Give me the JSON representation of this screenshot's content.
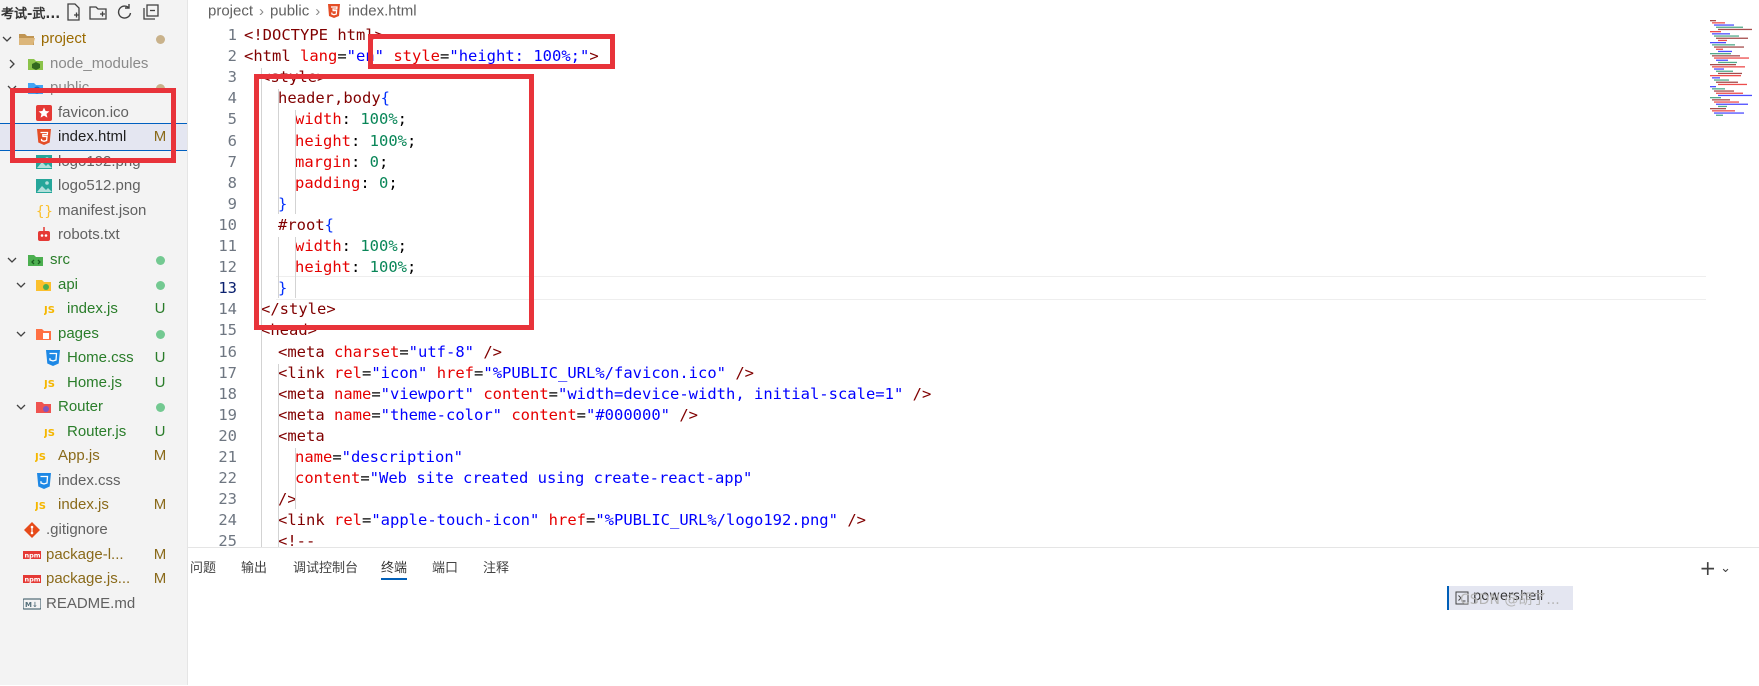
{
  "explorer": {
    "title": "考试-武...",
    "tree": [
      {
        "label": "project",
        "kind": "folder-open",
        "depth": 0,
        "color": "#9a6a00",
        "status": "dot",
        "status_color": "#c9b28b"
      },
      {
        "label": "node_modules",
        "kind": "node-folder",
        "depth": 1,
        "color": "#8a8a8a",
        "collapsed": true
      },
      {
        "label": "public",
        "kind": "public-folder",
        "depth": 1,
        "color": "#8a8a8a",
        "status": "dot",
        "status_color": "#c9b28b"
      },
      {
        "label": "favicon.ico",
        "kind": "favicon",
        "depth": 2,
        "color": "#616161"
      },
      {
        "label": "index.html",
        "kind": "html",
        "depth": 2,
        "color": "#1f1f1f",
        "badge": "M",
        "badge_color": "#8a6a1a",
        "selected": true
      },
      {
        "label": "logo192.png",
        "kind": "image",
        "depth": 2,
        "color": "#616161"
      },
      {
        "label": "logo512.png",
        "kind": "image",
        "depth": 2,
        "color": "#616161"
      },
      {
        "label": "manifest.json",
        "kind": "json",
        "depth": 2,
        "color": "#616161"
      },
      {
        "label": "robots.txt",
        "kind": "robot",
        "depth": 2,
        "color": "#616161"
      },
      {
        "label": "src",
        "kind": "src-folder",
        "depth": 1,
        "color": "#2a7d2a",
        "status": "dot",
        "status_color": "#73c991"
      },
      {
        "label": "api",
        "kind": "api-folder",
        "depth": 2,
        "color": "#2a7d2a",
        "status": "dot",
        "status_color": "#73c991"
      },
      {
        "label": "index.js",
        "kind": "js",
        "depth": 3,
        "color": "#2a7d2a",
        "badge": "U",
        "badge_color": "#2a7d2a"
      },
      {
        "label": "pages",
        "kind": "pages-folder",
        "depth": 2,
        "color": "#2a7d2a",
        "status": "dot",
        "status_color": "#73c991"
      },
      {
        "label": "Home.css",
        "kind": "css",
        "depth": 3,
        "color": "#2a7d2a",
        "badge": "U",
        "badge_color": "#2a7d2a"
      },
      {
        "label": "Home.js",
        "kind": "js",
        "depth": 3,
        "color": "#2a7d2a",
        "badge": "U",
        "badge_color": "#2a7d2a"
      },
      {
        "label": "Router",
        "kind": "router-folder",
        "depth": 2,
        "color": "#2a7d2a",
        "status": "dot",
        "status_color": "#73c991"
      },
      {
        "label": "Router.js",
        "kind": "js",
        "depth": 3,
        "color": "#2a7d2a",
        "badge": "U",
        "badge_color": "#2a7d2a"
      },
      {
        "label": "App.js",
        "kind": "js",
        "depth": 2,
        "color": "#8a6a1a",
        "badge": "M",
        "badge_color": "#8a6a1a"
      },
      {
        "label": "index.css",
        "kind": "css",
        "depth": 2,
        "color": "#616161"
      },
      {
        "label": "index.js",
        "kind": "js",
        "depth": 2,
        "color": "#8a6a1a",
        "badge": "M",
        "badge_color": "#8a6a1a"
      },
      {
        "label": ".gitignore",
        "kind": "git",
        "depth": 1,
        "color": "#616161"
      },
      {
        "label": "package-l...",
        "kind": "npm",
        "depth": 1,
        "color": "#8a6a1a",
        "badge": "M",
        "badge_color": "#8a6a1a"
      },
      {
        "label": "package.js...",
        "kind": "npm",
        "depth": 1,
        "color": "#8a6a1a",
        "badge": "M",
        "badge_color": "#8a6a1a"
      },
      {
        "label": "README.md",
        "kind": "md",
        "depth": 1,
        "color": "#616161"
      }
    ]
  },
  "breadcrumb": [
    "project",
    "public",
    "index.html"
  ],
  "editor": {
    "active_line": 13,
    "lines": [
      {
        "n": 1,
        "indent": 0,
        "tokens": [
          [
            "tag",
            "<!DOCTYPE html>"
          ]
        ]
      },
      {
        "n": 2,
        "indent": 0,
        "tokens": [
          [
            "tag",
            "<html "
          ],
          [
            "attr",
            "lang"
          ],
          [
            "plain",
            "="
          ],
          [
            "str",
            "\"en\""
          ],
          [
            "plain",
            " "
          ],
          [
            "attr",
            "style"
          ],
          [
            "plain",
            "="
          ],
          [
            "str",
            "\"height: 100%;\""
          ],
          [
            "tag",
            ">"
          ]
        ]
      },
      {
        "n": 3,
        "indent": 1,
        "tokens": [
          [
            "tag",
            "<style>"
          ]
        ]
      },
      {
        "n": 4,
        "indent": 2,
        "tokens": [
          [
            "sel",
            "header,body"
          ],
          [
            "brace",
            "{"
          ]
        ]
      },
      {
        "n": 5,
        "indent": 3,
        "tokens": [
          [
            "prop",
            "width"
          ],
          [
            "plain",
            ": "
          ],
          [
            "num",
            "100%"
          ],
          [
            "plain",
            ";"
          ]
        ]
      },
      {
        "n": 6,
        "indent": 3,
        "tokens": [
          [
            "prop",
            "height"
          ],
          [
            "plain",
            ": "
          ],
          [
            "num",
            "100%"
          ],
          [
            "plain",
            ";"
          ]
        ]
      },
      {
        "n": 7,
        "indent": 3,
        "tokens": [
          [
            "prop",
            "margin"
          ],
          [
            "plain",
            ": "
          ],
          [
            "num",
            "0"
          ],
          [
            "plain",
            ";"
          ]
        ]
      },
      {
        "n": 8,
        "indent": 3,
        "tokens": [
          [
            "prop",
            "padding"
          ],
          [
            "plain",
            ": "
          ],
          [
            "num",
            "0"
          ],
          [
            "plain",
            ";"
          ]
        ]
      },
      {
        "n": 9,
        "indent": 2,
        "tokens": [
          [
            "brace",
            "}"
          ]
        ]
      },
      {
        "n": 10,
        "indent": 2,
        "tokens": [
          [
            "sel",
            "#root"
          ],
          [
            "brace",
            "{"
          ]
        ]
      },
      {
        "n": 11,
        "indent": 3,
        "tokens": [
          [
            "prop",
            "width"
          ],
          [
            "plain",
            ": "
          ],
          [
            "num",
            "100%"
          ],
          [
            "plain",
            ";"
          ]
        ]
      },
      {
        "n": 12,
        "indent": 3,
        "tokens": [
          [
            "prop",
            "height"
          ],
          [
            "plain",
            ": "
          ],
          [
            "num",
            "100%"
          ],
          [
            "plain",
            ";"
          ]
        ]
      },
      {
        "n": 13,
        "indent": 2,
        "tokens": [
          [
            "brace",
            "}"
          ]
        ]
      },
      {
        "n": 14,
        "indent": 1,
        "tokens": [
          [
            "tag",
            "</style>"
          ]
        ]
      },
      {
        "n": 15,
        "indent": 1,
        "tokens": [
          [
            "tag",
            "<head>"
          ]
        ]
      },
      {
        "n": 16,
        "indent": 2,
        "tokens": [
          [
            "tag",
            "<meta "
          ],
          [
            "attr",
            "charset"
          ],
          [
            "plain",
            "="
          ],
          [
            "str",
            "\"utf-8\""
          ],
          [
            "tag",
            " />"
          ]
        ]
      },
      {
        "n": 17,
        "indent": 2,
        "tokens": [
          [
            "tag",
            "<link "
          ],
          [
            "attr",
            "rel"
          ],
          [
            "plain",
            "="
          ],
          [
            "str",
            "\"icon\""
          ],
          [
            "plain",
            " "
          ],
          [
            "attr",
            "href"
          ],
          [
            "plain",
            "="
          ],
          [
            "str",
            "\"%PUBLIC_URL%/favicon.ico\""
          ],
          [
            "tag",
            " />"
          ]
        ]
      },
      {
        "n": 18,
        "indent": 2,
        "tokens": [
          [
            "tag",
            "<meta "
          ],
          [
            "attr",
            "name"
          ],
          [
            "plain",
            "="
          ],
          [
            "str",
            "\"viewport\""
          ],
          [
            "plain",
            " "
          ],
          [
            "attr",
            "content"
          ],
          [
            "plain",
            "="
          ],
          [
            "str",
            "\"width=device-width, initial-scale=1\""
          ],
          [
            "tag",
            " />"
          ]
        ]
      },
      {
        "n": 19,
        "indent": 2,
        "tokens": [
          [
            "tag",
            "<meta "
          ],
          [
            "attr",
            "name"
          ],
          [
            "plain",
            "="
          ],
          [
            "str",
            "\"theme-color\""
          ],
          [
            "plain",
            " "
          ],
          [
            "attr",
            "content"
          ],
          [
            "plain",
            "="
          ],
          [
            "str",
            "\"#000000\""
          ],
          [
            "tag",
            " />"
          ]
        ]
      },
      {
        "n": 20,
        "indent": 2,
        "tokens": [
          [
            "tag",
            "<meta"
          ]
        ]
      },
      {
        "n": 21,
        "indent": 3,
        "tokens": [
          [
            "attr",
            "name"
          ],
          [
            "plain",
            "="
          ],
          [
            "str",
            "\"description\""
          ]
        ]
      },
      {
        "n": 22,
        "indent": 3,
        "tokens": [
          [
            "attr",
            "content"
          ],
          [
            "plain",
            "="
          ],
          [
            "str",
            "\"Web site created using create-react-app\""
          ]
        ]
      },
      {
        "n": 23,
        "indent": 2,
        "tokens": [
          [
            "tag",
            "/>"
          ]
        ]
      },
      {
        "n": 24,
        "indent": 2,
        "tokens": [
          [
            "tag",
            "<link "
          ],
          [
            "attr",
            "rel"
          ],
          [
            "plain",
            "="
          ],
          [
            "str",
            "\"apple-touch-icon\""
          ],
          [
            "plain",
            " "
          ],
          [
            "attr",
            "href"
          ],
          [
            "plain",
            "="
          ],
          [
            "str",
            "\"%PUBLIC_URL%/logo192.png\""
          ],
          [
            "tag",
            " />"
          ]
        ]
      },
      {
        "n": 25,
        "indent": 2,
        "tokens": [
          [
            "tag",
            "<!--"
          ]
        ]
      }
    ]
  },
  "panel": {
    "tabs": [
      "问题",
      "输出",
      "调试控制台",
      "终端",
      "端口",
      "注释"
    ],
    "active_tab": "终端",
    "actions": "+ ⌄",
    "terminal_name": "powershell",
    "watermark": "CSDN @胡了..."
  },
  "colors": {
    "annotation_red": "#e8333a",
    "accent": "#005fb8"
  }
}
